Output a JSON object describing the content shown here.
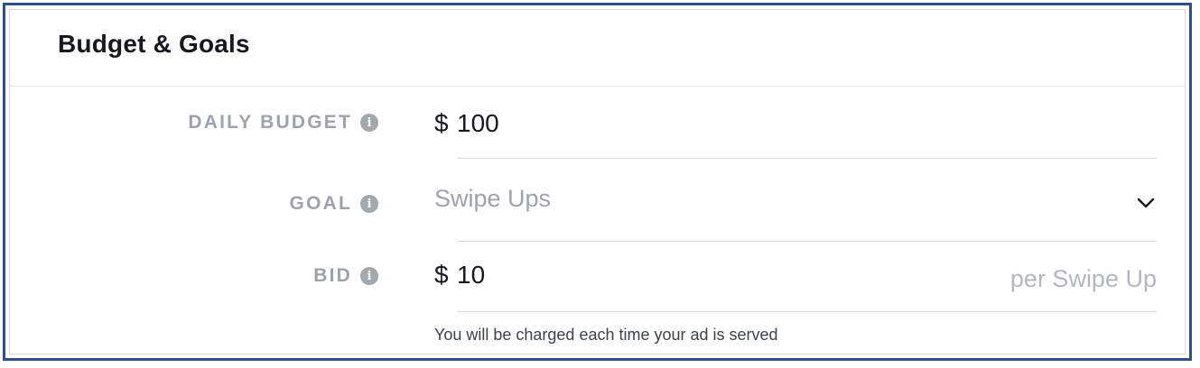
{
  "header": {
    "title": "Budget & Goals"
  },
  "daily_budget": {
    "label": "DAILY BUDGET",
    "info_icon": "i",
    "currency": "$",
    "value": "100"
  },
  "goal": {
    "label": "GOAL",
    "info_icon": "i",
    "selected": "Swipe Ups"
  },
  "bid": {
    "label": "BID",
    "info_icon": "i",
    "currency": "$",
    "value": "10",
    "suffix": "per Swipe Up",
    "helper": "You will be charged each time your ad is served"
  },
  "colors": {
    "frame_border": "#2f4f8c",
    "label": "#9ea3ab",
    "text": "#16191f"
  }
}
